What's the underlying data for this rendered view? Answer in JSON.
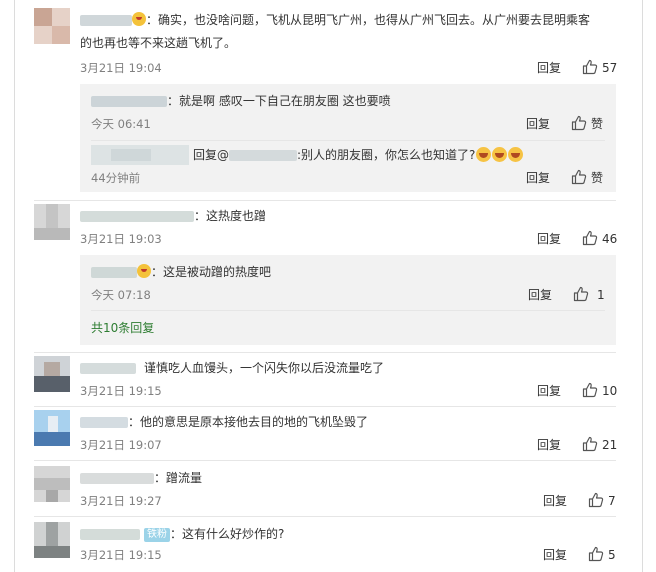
{
  "comments": [
    {
      "text": "：确实，也没啥问题，飞机从昆明飞广州，也得从广州飞回去。从广州要去昆明乘客",
      "text2": "的也再也等不来这趟飞机了。",
      "time": "3月21日 19:04",
      "reply": "回复",
      "likes": "57",
      "subs": [
        {
          "text": "：就是啊 感叹一下自己在朋友圈 这也要喷",
          "time": "今天 06:41",
          "reply": "回复",
          "like": "赞"
        },
        {
          "prefix": "回复@",
          "text": ":别人的朋友圈，你怎么也知道了?",
          "time": "44分钟前",
          "reply": "回复",
          "like": "赞"
        }
      ]
    },
    {
      "text": "：这热度也蹭",
      "time": "3月21日 19:03",
      "reply": "回复",
      "likes": "46",
      "subs": [
        {
          "text": "：这是被动蹭的热度吧",
          "time": "今天 07:18",
          "reply": "回复",
          "like": "1"
        }
      ],
      "more": "共10条回复"
    },
    {
      "text": "谨慎吃人血馒头，一个闪失你以后没流量吃了",
      "time": "3月21日 19:15",
      "reply": "回复",
      "likes": "10"
    },
    {
      "text": "：他的意思是原本接他去目的地的飞机坠毁了",
      "time": "3月21日 19:07",
      "reply": "回复",
      "likes": "21"
    },
    {
      "text": "：蹭流量",
      "time": "3月21日 19:27",
      "reply": "回复",
      "likes": "7"
    },
    {
      "badge": "铁粉",
      "text": "：这有什么好炒作的?",
      "time": "3月21日 19:15",
      "reply": "回复",
      "likes": "5"
    }
  ],
  "colors": {
    "link": "#2e7d32",
    "subBg": "#f2f2f2",
    "time": "#808080"
  },
  "icons": {
    "like": "thumbs-up-icon"
  }
}
